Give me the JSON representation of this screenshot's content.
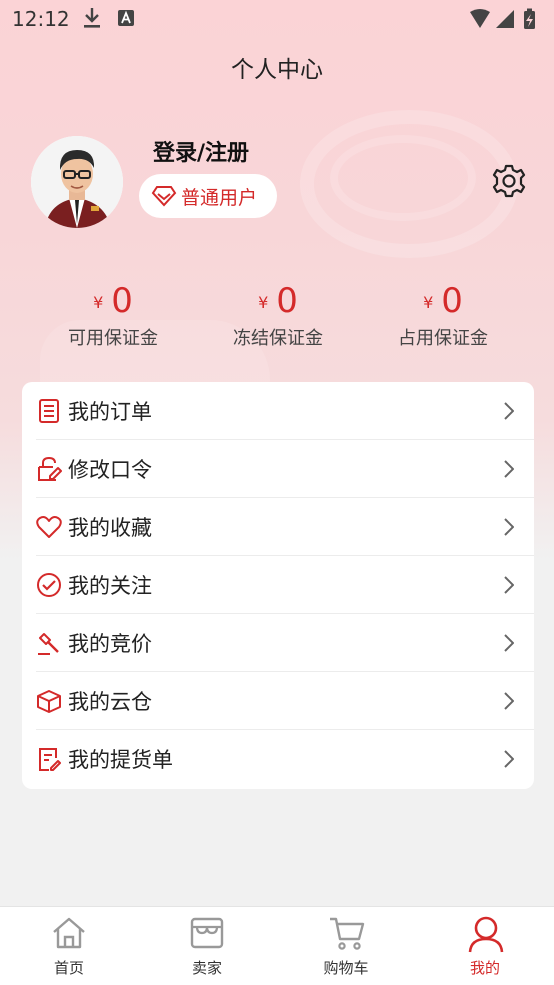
{
  "status": {
    "time": "12:12"
  },
  "header": {
    "title": "个人中心"
  },
  "profile": {
    "login_label": "登录/注册",
    "user_type": "普通用户"
  },
  "stats": [
    {
      "currency": "¥",
      "value": "0",
      "label": "可用保证金"
    },
    {
      "currency": "¥",
      "value": "0",
      "label": "冻结保证金"
    },
    {
      "currency": "¥",
      "value": "0",
      "label": "占用保证金"
    }
  ],
  "menu": {
    "items": [
      {
        "label": "我的订单",
        "icon": "order-list-icon"
      },
      {
        "label": "修改口令",
        "icon": "edit-password-icon"
      },
      {
        "label": "我的收藏",
        "icon": "heart-icon"
      },
      {
        "label": "我的关注",
        "icon": "check-circle-icon"
      },
      {
        "label": "我的竞价",
        "icon": "auction-hammer-icon"
      },
      {
        "label": "我的云仓",
        "icon": "box-icon"
      },
      {
        "label": "我的提货单",
        "icon": "pickup-list-icon"
      }
    ]
  },
  "tabbar": {
    "tabs": [
      {
        "label": "首页",
        "icon": "home-icon",
        "active": false
      },
      {
        "label": "卖家",
        "icon": "store-icon",
        "active": false
      },
      {
        "label": "购物车",
        "icon": "cart-icon",
        "active": false
      },
      {
        "label": "我的",
        "icon": "user-icon",
        "active": true
      }
    ]
  },
  "colors": {
    "accent": "#d42a2a",
    "header_bg": "#fbd3d6",
    "page_bg": "#f1f1f1"
  }
}
